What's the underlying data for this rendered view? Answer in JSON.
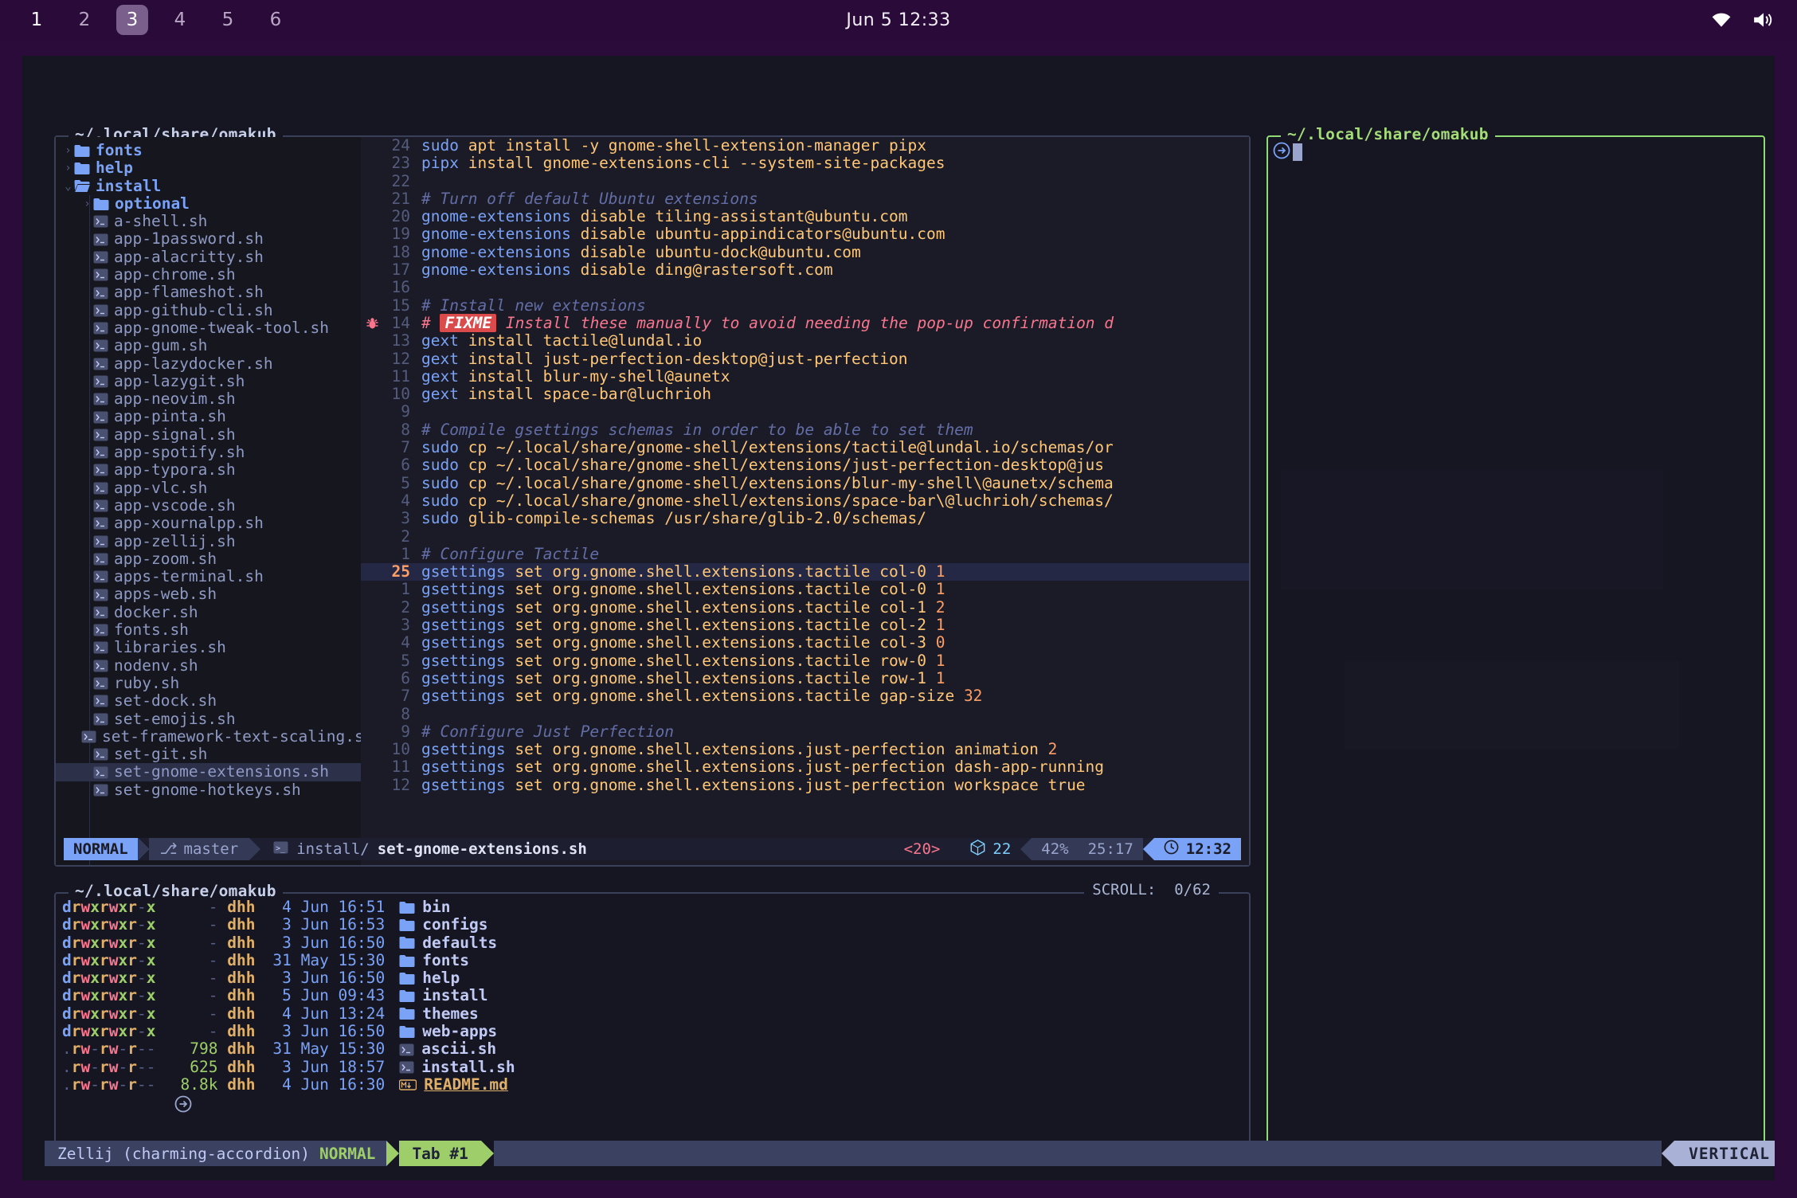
{
  "topbar": {
    "workspaces": [
      "1",
      "2",
      "3",
      "4",
      "5",
      "6"
    ],
    "active_workspace": "3",
    "clock": "Jun 5  12:33",
    "tray": [
      "wifi-icon",
      "volume-icon"
    ]
  },
  "editor_pane": {
    "title": "~/.local/share/omakub",
    "tree": [
      {
        "depth": 0,
        "type": "dir",
        "chev": "›",
        "label": "fonts",
        "open": false
      },
      {
        "depth": 0,
        "type": "dir",
        "chev": "›",
        "label": "help",
        "open": false
      },
      {
        "depth": 0,
        "type": "dir",
        "chev": "⌄",
        "label": "install",
        "open": true
      },
      {
        "depth": 1,
        "type": "dir",
        "chev": "›",
        "label": "optional",
        "open": false
      },
      {
        "depth": 1,
        "type": "file",
        "label": "a-shell.sh"
      },
      {
        "depth": 1,
        "type": "file",
        "label": "app-1password.sh"
      },
      {
        "depth": 1,
        "type": "file",
        "label": "app-alacritty.sh"
      },
      {
        "depth": 1,
        "type": "file",
        "label": "app-chrome.sh"
      },
      {
        "depth": 1,
        "type": "file",
        "label": "app-flameshot.sh"
      },
      {
        "depth": 1,
        "type": "file",
        "label": "app-github-cli.sh"
      },
      {
        "depth": 1,
        "type": "file",
        "label": "app-gnome-tweak-tool.sh"
      },
      {
        "depth": 1,
        "type": "file",
        "label": "app-gum.sh"
      },
      {
        "depth": 1,
        "type": "file",
        "label": "app-lazydocker.sh"
      },
      {
        "depth": 1,
        "type": "file",
        "label": "app-lazygit.sh"
      },
      {
        "depth": 1,
        "type": "file",
        "label": "app-neovim.sh"
      },
      {
        "depth": 1,
        "type": "file",
        "label": "app-pinta.sh"
      },
      {
        "depth": 1,
        "type": "file",
        "label": "app-signal.sh"
      },
      {
        "depth": 1,
        "type": "file",
        "label": "app-spotify.sh"
      },
      {
        "depth": 1,
        "type": "file",
        "label": "app-typora.sh"
      },
      {
        "depth": 1,
        "type": "file",
        "label": "app-vlc.sh"
      },
      {
        "depth": 1,
        "type": "file",
        "label": "app-vscode.sh"
      },
      {
        "depth": 1,
        "type": "file",
        "label": "app-xournalpp.sh"
      },
      {
        "depth": 1,
        "type": "file",
        "label": "app-zellij.sh"
      },
      {
        "depth": 1,
        "type": "file",
        "label": "app-zoom.sh"
      },
      {
        "depth": 1,
        "type": "file",
        "label": "apps-terminal.sh"
      },
      {
        "depth": 1,
        "type": "file",
        "label": "apps-web.sh"
      },
      {
        "depth": 1,
        "type": "file",
        "label": "docker.sh"
      },
      {
        "depth": 1,
        "type": "file",
        "label": "fonts.sh"
      },
      {
        "depth": 1,
        "type": "file",
        "label": "libraries.sh"
      },
      {
        "depth": 1,
        "type": "file",
        "label": "nodenv.sh"
      },
      {
        "depth": 1,
        "type": "file",
        "label": "ruby.sh"
      },
      {
        "depth": 1,
        "type": "file",
        "label": "set-dock.sh"
      },
      {
        "depth": 1,
        "type": "file",
        "label": "set-emojis.sh"
      },
      {
        "depth": 1,
        "type": "file",
        "label": "set-framework-text-scaling.sh"
      },
      {
        "depth": 1,
        "type": "file",
        "label": "set-git.sh"
      },
      {
        "depth": 1,
        "type": "file",
        "label": "set-gnome-extensions.sh",
        "selected": true
      },
      {
        "depth": 1,
        "type": "file",
        "label": "set-gnome-hotkeys.sh"
      }
    ],
    "code_lines": [
      {
        "num": "24",
        "spans": [
          {
            "t": "sudo",
            "c": "kw"
          },
          {
            "t": " apt install -y gnome-shell-extension-manager pipx",
            "c": "str"
          }
        ]
      },
      {
        "num": "23",
        "spans": [
          {
            "t": "pipx",
            "c": "kw"
          },
          {
            "t": " install gnome-extensions-cli --system-site-packages",
            "c": "str"
          }
        ]
      },
      {
        "num": "22",
        "spans": []
      },
      {
        "num": "21",
        "spans": [
          {
            "t": "# Turn off default Ubuntu extensions",
            "c": "cmt"
          }
        ]
      },
      {
        "num": "20",
        "spans": [
          {
            "t": "gnome-extensions",
            "c": "kw"
          },
          {
            "t": " disable tiling-assistant@ubuntu.com",
            "c": "str"
          }
        ]
      },
      {
        "num": "19",
        "spans": [
          {
            "t": "gnome-extensions",
            "c": "kw"
          },
          {
            "t": " disable ubuntu-appindicators@ubuntu.com",
            "c": "str"
          }
        ]
      },
      {
        "num": "18",
        "spans": [
          {
            "t": "gnome-extensions",
            "c": "kw"
          },
          {
            "t": " disable ubuntu-dock@ubuntu.com",
            "c": "str"
          }
        ]
      },
      {
        "num": "17",
        "spans": [
          {
            "t": "gnome-extensions",
            "c": "kw"
          },
          {
            "t": " disable ding@rastersoft.com",
            "c": "str"
          }
        ]
      },
      {
        "num": "16",
        "spans": []
      },
      {
        "num": "15",
        "spans": [
          {
            "t": "# Install new extensions",
            "c": "cmt"
          }
        ]
      },
      {
        "num": "14",
        "bug": true,
        "fixme": true,
        "prefix": "# ",
        "tag": "FIXME",
        "rest": " Install these manually to avoid needing the pop-up confirmation d"
      },
      {
        "num": "13",
        "spans": [
          {
            "t": "gext",
            "c": "kw"
          },
          {
            "t": " install tactile@lundal.io",
            "c": "str"
          }
        ]
      },
      {
        "num": "12",
        "spans": [
          {
            "t": "gext",
            "c": "kw"
          },
          {
            "t": " install just-perfection-desktop@just-perfection",
            "c": "str"
          }
        ]
      },
      {
        "num": "11",
        "spans": [
          {
            "t": "gext",
            "c": "kw"
          },
          {
            "t": " install blur-my-shell@aunetx",
            "c": "str"
          }
        ]
      },
      {
        "num": "10",
        "spans": [
          {
            "t": "gext",
            "c": "kw"
          },
          {
            "t": " install space-bar@luchrioh",
            "c": "str"
          }
        ]
      },
      {
        "num": "9",
        "spans": []
      },
      {
        "num": "8",
        "spans": [
          {
            "t": "# Compile gsettings schemas in order to be able to set them",
            "c": "cmt"
          }
        ]
      },
      {
        "num": "7",
        "spans": [
          {
            "t": "sudo",
            "c": "kw"
          },
          {
            "t": " cp ~/.local/share/gnome-shell/extensions/tactile@lundal.io/schemas/or",
            "c": "str"
          }
        ]
      },
      {
        "num": "6",
        "spans": [
          {
            "t": "sudo",
            "c": "kw"
          },
          {
            "t": " cp ~/.local/share/gnome-shell/extensions/just-perfection-desktop@jus",
            "c": "str"
          }
        ]
      },
      {
        "num": "5",
        "spans": [
          {
            "t": "sudo",
            "c": "kw"
          },
          {
            "t": " cp ~/.local/share/gnome-shell/extensions/blur-my-shell\\@aunetx/schema",
            "c": "str"
          }
        ]
      },
      {
        "num": "4",
        "spans": [
          {
            "t": "sudo",
            "c": "kw"
          },
          {
            "t": " cp ~/.local/share/gnome-shell/extensions/space-bar\\@luchrioh/schemas/",
            "c": "str"
          }
        ]
      },
      {
        "num": "3",
        "spans": [
          {
            "t": "sudo",
            "c": "kw"
          },
          {
            "t": " glib-compile-schemas /usr/share/glib-2.0/schemas/",
            "c": "str"
          }
        ]
      },
      {
        "num": "2",
        "spans": []
      },
      {
        "num": "1",
        "spans": [
          {
            "t": "# Configure Tactile",
            "c": "cmt"
          }
        ]
      },
      {
        "num": "25",
        "current": true,
        "spans": [
          {
            "t": "gsettings",
            "c": "kw"
          },
          {
            "t": " set org.gnome.shell.extensions.tactile col-0 ",
            "c": "str"
          },
          {
            "t": "1",
            "c": "num"
          }
        ]
      },
      {
        "num": "1",
        "spans": [
          {
            "t": "gsettings",
            "c": "kw"
          },
          {
            "t": " set org.gnome.shell.extensions.tactile col-0 ",
            "c": "str"
          },
          {
            "t": "1",
            "c": "num"
          }
        ]
      },
      {
        "num": "2",
        "spans": [
          {
            "t": "gsettings",
            "c": "kw"
          },
          {
            "t": " set org.gnome.shell.extensions.tactile col-1 ",
            "c": "str"
          },
          {
            "t": "2",
            "c": "num"
          }
        ]
      },
      {
        "num": "3",
        "spans": [
          {
            "t": "gsettings",
            "c": "kw"
          },
          {
            "t": " set org.gnome.shell.extensions.tactile col-2 ",
            "c": "str"
          },
          {
            "t": "1",
            "c": "num"
          }
        ]
      },
      {
        "num": "4",
        "spans": [
          {
            "t": "gsettings",
            "c": "kw"
          },
          {
            "t": " set org.gnome.shell.extensions.tactile col-3 ",
            "c": "str"
          },
          {
            "t": "0",
            "c": "num"
          }
        ]
      },
      {
        "num": "5",
        "spans": [
          {
            "t": "gsettings",
            "c": "kw"
          },
          {
            "t": " set org.gnome.shell.extensions.tactile row-0 ",
            "c": "str"
          },
          {
            "t": "1",
            "c": "num"
          }
        ]
      },
      {
        "num": "6",
        "spans": [
          {
            "t": "gsettings",
            "c": "kw"
          },
          {
            "t": " set org.gnome.shell.extensions.tactile row-1 ",
            "c": "str"
          },
          {
            "t": "1",
            "c": "num"
          }
        ]
      },
      {
        "num": "7",
        "spans": [
          {
            "t": "gsettings",
            "c": "kw"
          },
          {
            "t": " set org.gnome.shell.extensions.tactile gap-size ",
            "c": "str"
          },
          {
            "t": "32",
            "c": "num"
          }
        ]
      },
      {
        "num": "8",
        "spans": []
      },
      {
        "num": "9",
        "spans": [
          {
            "t": "# Configure Just Perfection",
            "c": "cmt"
          }
        ]
      },
      {
        "num": "10",
        "spans": [
          {
            "t": "gsettings",
            "c": "kw"
          },
          {
            "t": " set org.gnome.shell.extensions.just-perfection animation ",
            "c": "str"
          },
          {
            "t": "2",
            "c": "num"
          }
        ]
      },
      {
        "num": "11",
        "spans": [
          {
            "t": "gsettings",
            "c": "kw"
          },
          {
            "t": " set org.gnome.shell.extensions.just-perfection dash-app-running",
            "c": "str"
          }
        ]
      },
      {
        "num": "12",
        "spans": [
          {
            "t": "gsettings",
            "c": "kw"
          },
          {
            "t": " set org.gnome.shell.extensions.just-perfection workspace true",
            "c": "str"
          }
        ]
      }
    ],
    "statusline": {
      "mode": "NORMAL",
      "branch": "master",
      "file_dir": "install/",
      "file_name": "set-gnome-extensions.sh",
      "lsp": "<20>",
      "diagnostics": "22",
      "percent": "42%",
      "position": "25:17",
      "time": "12:32"
    }
  },
  "ls_pane": {
    "title": "~/.local/share/omakub",
    "scroll_label": "SCROLL:",
    "scroll_value": "0/62",
    "rows": [
      {
        "perm": "drwxrwxr-x",
        "size": "-",
        "user": "dhh",
        "date": "4 Jun 16:51",
        "name": "bin",
        "kind": "dir"
      },
      {
        "perm": "drwxrwxr-x",
        "size": "-",
        "user": "dhh",
        "date": "3 Jun 16:53",
        "name": "configs",
        "kind": "dir"
      },
      {
        "perm": "drwxrwxr-x",
        "size": "-",
        "user": "dhh",
        "date": "3 Jun 16:50",
        "name": "defaults",
        "kind": "dir"
      },
      {
        "perm": "drwxrwxr-x",
        "size": "-",
        "user": "dhh",
        "date": "31 May 15:30",
        "name": "fonts",
        "kind": "dir"
      },
      {
        "perm": "drwxrwxr-x",
        "size": "-",
        "user": "dhh",
        "date": "3 Jun 16:50",
        "name": "help",
        "kind": "dir"
      },
      {
        "perm": "drwxrwxr-x",
        "size": "-",
        "user": "dhh",
        "date": "5 Jun 09:43",
        "name": "install",
        "kind": "dir"
      },
      {
        "perm": "drwxrwxr-x",
        "size": "-",
        "user": "dhh",
        "date": "4 Jun 13:24",
        "name": "themes",
        "kind": "dir"
      },
      {
        "perm": "drwxrwxr-x",
        "size": "-",
        "user": "dhh",
        "date": "3 Jun 16:50",
        "name": "web-apps",
        "kind": "dir"
      },
      {
        "perm": ".rw-rw-r--",
        "size": "798",
        "user": "dhh",
        "date": "31 May 15:30",
        "name": "ascii.sh",
        "kind": "script"
      },
      {
        "perm": ".rw-rw-r--",
        "size": "625",
        "user": "dhh",
        "date": "3 Jun 18:57",
        "name": "install.sh",
        "kind": "script"
      },
      {
        "perm": ".rw-rw-r--",
        "size": "8.8k",
        "user": "dhh",
        "date": "4 Jun 16:30",
        "name": "README.md",
        "kind": "md"
      }
    ]
  },
  "shell_pane": {
    "title": "~/.local/share/omakub",
    "prompt": "",
    "active": true
  },
  "zellij_bar": {
    "session": "Zellij (charming-accordion)",
    "mode": "NORMAL",
    "tab": "Tab #1",
    "layout": "VERTICAL"
  },
  "colors": {
    "bg": "#1a1b26",
    "panel": "#16161e",
    "accent_blue": "#7aa2f7",
    "accent_green": "#9ece6a",
    "accent_orange": "#ffc777",
    "accent_red": "#f7768e",
    "desktop": "#2b0b3a"
  }
}
